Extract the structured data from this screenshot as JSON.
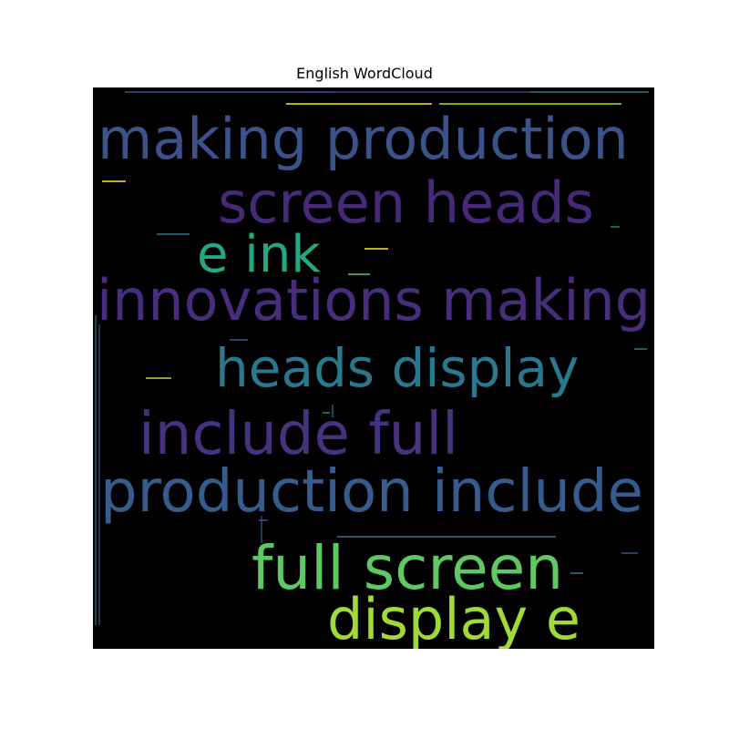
{
  "chart_data": {
    "type": "wordcloud",
    "title": "English WordCloud",
    "background": "#000000",
    "words": [
      {
        "text": "making production",
        "color": "#3b528b",
        "rank": 1
      },
      {
        "text": "screen heads",
        "color": "#482878",
        "rank": 2
      },
      {
        "text": "e ink",
        "color": "#22a884",
        "rank": 3
      },
      {
        "text": "innovations making",
        "color": "#472d7b",
        "rank": 4
      },
      {
        "text": "heads display",
        "color": "#2a788e",
        "rank": 5
      },
      {
        "text": "include full",
        "color": "#46327e",
        "rank": 6
      },
      {
        "text": "production include",
        "color": "#365c8d",
        "rank": 7
      },
      {
        "text": "full screen",
        "color": "#5ec962",
        "rank": 8
      },
      {
        "text": "display e",
        "color": "#a0da39",
        "rank": 9
      }
    ]
  }
}
